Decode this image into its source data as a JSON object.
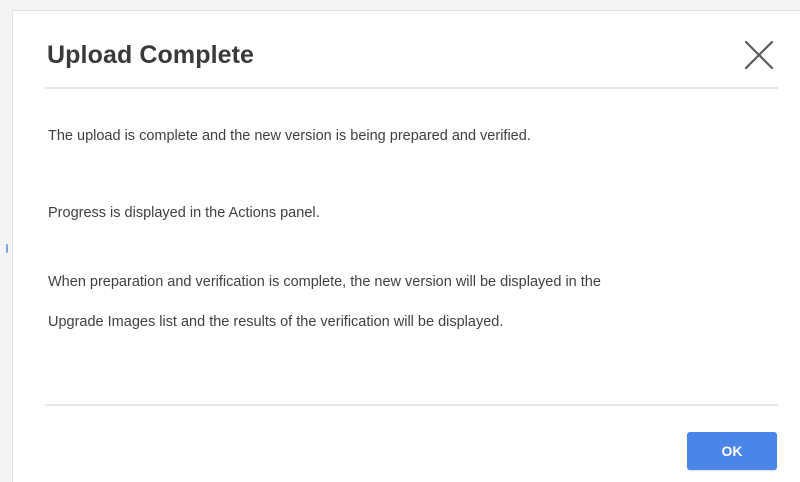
{
  "dialog": {
    "title": "Upload Complete",
    "close_icon": "close-icon",
    "paragraphs": [
      "The upload is complete and the new version is being prepared and verified.",
      "Progress is displayed in the Actions panel.",
      "When preparation and verification is complete, the new version will be displayed in the",
      "Upgrade Images list and the results of the verification will be displayed."
    ],
    "ok_label": "OK"
  },
  "colors": {
    "accent": "#4a86e8",
    "title_text": "#3a3a3a",
    "body_text": "#404040",
    "divider": "#e6e6e6"
  }
}
